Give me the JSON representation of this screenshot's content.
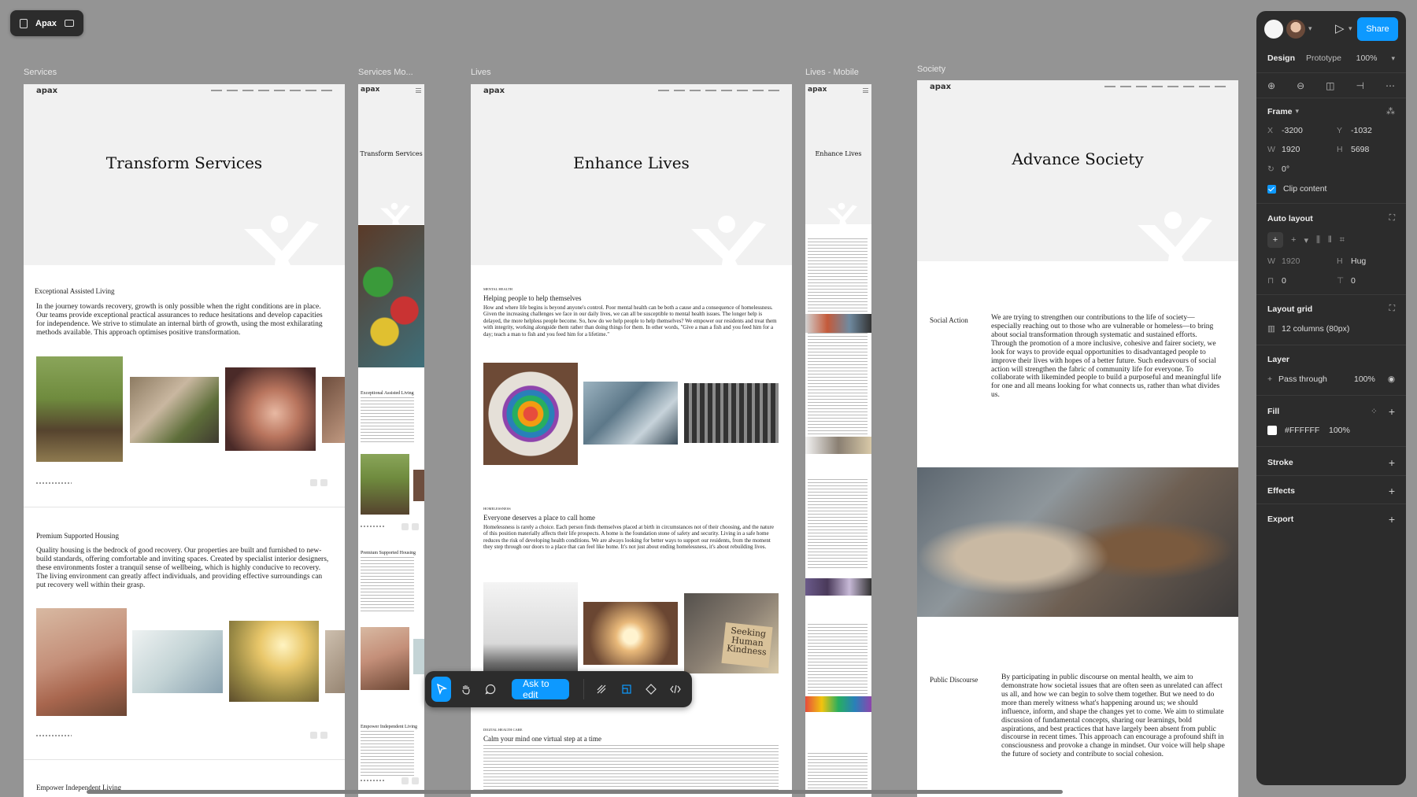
{
  "file": {
    "name": "Apax"
  },
  "frames": [
    {
      "label": "Services"
    },
    {
      "label": "Services Mo..."
    },
    {
      "label": "Lives"
    },
    {
      "label": "Lives - Mobile"
    },
    {
      "label": "Society"
    }
  ],
  "site": {
    "logo": "apax"
  },
  "services": {
    "hero_title": "Transform Services",
    "s1_heading": "Exceptional Assisted Living",
    "s1_body": "In the journey towards recovery, growth is only possible when the right conditions are in place. Our teams provide exceptional practical assurances to reduce hesitations and develop capacities for independence. We strive to stimulate an internal birth of growth, using the most exhilarating methods available. This approach optimises positive transformation.",
    "s2_heading": "Premium Supported Housing",
    "s2_body": "Quality housing is the bedrock of good recovery. Our properties are built and furnished to new-build standards, offering comfortable and inviting spaces. Created by specialist interior designers, these environments foster a tranquil sense of wellbeing, which is highly conducive to recovery. The living environment can greatly affect individuals, and providing effective surroundings can put recovery well within their grasp.",
    "s3_heading": "Empower Independent Living"
  },
  "services_mobile": {
    "hero_title": "Transform Services",
    "s1_heading": "Exceptional Assisted Living",
    "s2_heading": "Premium Supported Housing",
    "s3_heading": "Empower Independent Living"
  },
  "lives": {
    "hero_title": "Enhance Lives",
    "s1_kicker": "MENTAL HEALTH",
    "s1_heading": "Helping people to help themselves",
    "s1_body": "How and where life begins is beyond anyone's control. Poor mental health can be both a cause and a consequence of homelessness. Given the increasing challenges we face in our daily lives, we can all be susceptible to mental health issues. The longer help is delayed, the more helpless people become. So, how do we help people to help themselves? We empower our residents and treat them with integrity, working alongside them rather than doing things for them. In other words, \"Give a man a fish and you feed him for a day; teach a man to fish and you feed him for a lifetime.\"",
    "s2_kicker": "HOMELESSNESS",
    "s2_heading": "Everyone deserves a place to call home",
    "s2_body": "Homelessness is rarely a choice. Each person finds themselves placed at birth in circumstances not of their choosing, and the nature of this position materially affects their life prospects. A home is the foundation stone of safety and security. Living in a safe home reduces the risk of developing health conditions. We are always looking for better ways to support our residents, from the moment they step through our doors to a place that can feel like home. It's not just about ending homelessness, it's about rebuilding lives.",
    "sign_text": "Seeking Human Kindness",
    "s3_kicker": "DIGITAL HEALTH CARE",
    "s3_heading": "Calm your mind one virtual step at a time"
  },
  "lives_mobile": {
    "hero_title": "Enhance Lives"
  },
  "society": {
    "hero_title": "Advance Society",
    "s1_heading": "Social Action",
    "s1_body": "We are trying to strengthen our contributions to the life of society—especially reaching out to those who are vulnerable or homeless—to bring about social transformation through systematic and sustained efforts. Through the promotion of a more inclusive, cohesive and fairer society, we look for ways to provide equal opportunities to disadvantaged people to improve their lives with hopes of a better future. Such endeavours of social action will strengthen the fabric of community life for everyone. To collaborate with likeminded people to build a purposeful and meaningful life for one and all means looking for what connects us, rather than what divides us.",
    "s2_heading": "Public Discourse",
    "s2_body": "By participating in public discourse on mental health, we aim to demonstrate how societal issues that are often seen as unrelated can affect us all, and how we can begin to solve them together. But we need to do more than merely witness what's happening around us; we should influence, inform, and shape the changes yet to come. We aim to stimulate discussion of fundamental concepts, sharing our learnings, bold aspirations, and best practices that have largely been absent from public discourse in recent times. This approach can encourage a profound shift in consciousness and provoke a change in mindset. Our voice will help shape the future of society and contribute to social cohesion."
  },
  "toolbar": {
    "ask_label": "Ask to edit"
  },
  "panel": {
    "share_label": "Share",
    "tab_design": "Design",
    "tab_prototype": "Prototype",
    "zoom": "100%",
    "frame_label": "Frame",
    "x_label": "X",
    "x_value": "-3200",
    "y_label": "Y",
    "y_value": "-1032",
    "w_label": "W",
    "w_value": "1920",
    "h_label": "H",
    "h_value": "5698",
    "rotation": "0°",
    "clip_content": "Clip content",
    "auto_layout": "Auto layout",
    "al_w_label": "W",
    "al_w_value": "1920",
    "al_h_label": "H",
    "al_h_value": "Hug",
    "gap_value": "0",
    "padding_value": "0",
    "layout_grid": "Layout grid",
    "grid_value": "12 columns (80px)",
    "layer": "Layer",
    "blend_mode": "Pass through",
    "layer_opacity": "100%",
    "fill": "Fill",
    "fill_hex": "#FFFFFF",
    "fill_opacity": "100%",
    "stroke": "Stroke",
    "effects": "Effects",
    "export": "Export"
  },
  "colors": {
    "accent": "#0d99ff",
    "canvas": "#949494",
    "panel": "#2c2c2c",
    "brand_teal": "#35c1d0"
  }
}
